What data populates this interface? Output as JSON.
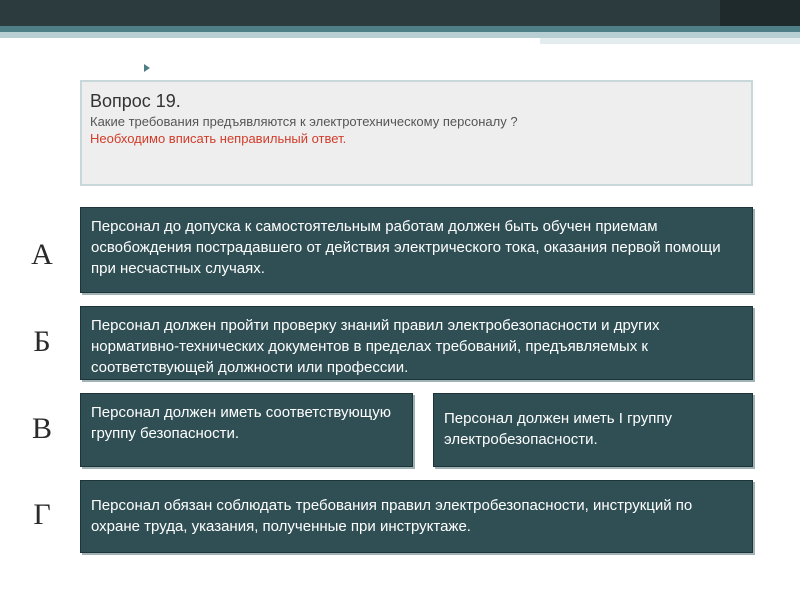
{
  "question": {
    "title": "Вопрос 19.",
    "text": "Какие требования предъявляются к электротехническому персоналу ?",
    "note": "Необходимо вписать неправильный ответ."
  },
  "options": [
    {
      "letter": "А",
      "answers": [
        "Персонал до допуска к самостоятельным работам должен быть обучен приемам освобождения пострадавшего от действия электрического тока, оказания первой помощи при несчастных случаях."
      ]
    },
    {
      "letter": "Б",
      "answers": [
        "Персонал должен пройти проверку знаний правил электробезопасности и других нормативно-технических документов в пределах требований, предъявляемых к соответствующей должности или профессии."
      ]
    },
    {
      "letter": "В",
      "answers": [
        "Персонал должен иметь соответствующую группу безопасности.",
        "Персонал должен иметь I группу электробезопасности."
      ]
    },
    {
      "letter": "Г",
      "answers": [
        "Персонал обязан соблюдать требования правил электробезопасности, инструкций по охране труда, указания, полученные при  инструктаже."
      ]
    }
  ],
  "colors": {
    "answer_bg": "#2f4f54",
    "note_red": "#d23c2a",
    "header_dark": "#2c3b3d"
  }
}
